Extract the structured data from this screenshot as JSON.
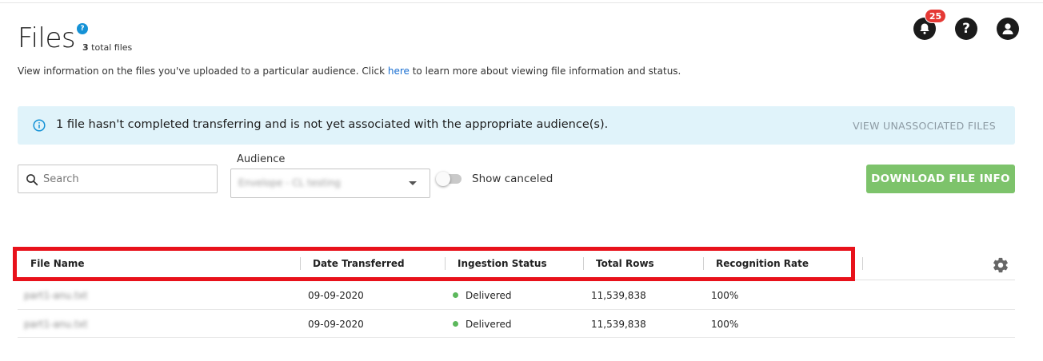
{
  "page": {
    "title": "Files",
    "help_badge": "?",
    "total_count": "3",
    "total_label": "total files",
    "description_before": "View information on the files you've uploaded to a particular audience. Click ",
    "description_link": "here",
    "description_after": " to learn more about viewing file information and status."
  },
  "header": {
    "notification_count": "25",
    "icons": [
      "bell-icon",
      "question-icon",
      "user-icon"
    ]
  },
  "banner": {
    "message": "1 file hasn't completed transferring and is not yet associated with the appropriate audience(s).",
    "action_label": "VIEW UNASSOCIATED FILES"
  },
  "filters": {
    "search_placeholder": "Search",
    "audience_label": "Audience",
    "audience_value": "Envelope - CL testing",
    "show_canceled_label": "Show canceled",
    "download_label": "DOWNLOAD FILE INFO"
  },
  "table": {
    "columns": [
      "File Name",
      "Date Transferred",
      "Ingestion Status",
      "Total Rows",
      "Recognition Rate"
    ],
    "rows": [
      {
        "file_name": "part1-anu.txt",
        "date": "09-09-2020",
        "status": "Delivered",
        "total_rows": "11,539,838",
        "rate": "100%"
      },
      {
        "file_name": "part1-anu.txt",
        "date": "09-09-2020",
        "status": "Delivered",
        "total_rows": "11,539,838",
        "rate": "100%"
      }
    ]
  },
  "colors": {
    "accent_blue": "#1592d6",
    "banner_bg": "#e0f3fa",
    "download_green": "#7dc36b",
    "delivered_green": "#5cb85c",
    "highlight_red": "#e8121b",
    "notification_red": "#e53935"
  }
}
